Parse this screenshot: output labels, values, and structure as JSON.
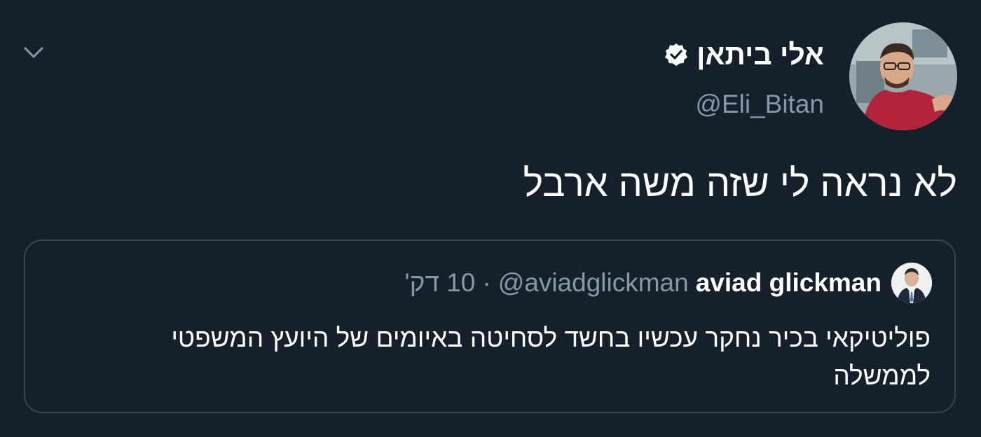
{
  "icons": {
    "chevron": "chevron-down-icon",
    "verified": "verified-badge-icon"
  },
  "colors": {
    "background": "#15202b",
    "text_primary": "#ffffff",
    "text_secondary": "#8899a6",
    "border": "#38444d"
  },
  "tweet": {
    "author": {
      "display_name": "אלי ביתאן",
      "handle": "@Eli_Bitan",
      "verified": true
    },
    "text": "לא נראה לי שזה משה ארבל"
  },
  "quoted_tweet": {
    "author": {
      "display_name": "aviad glickman",
      "handle": "@aviadglickman"
    },
    "separator": "·",
    "time": "10 דק'",
    "text": "פוליטיקאי בכיר נחקר עכשיו בחשד לסחיטה באיומים של היועץ המשפטי לממשלה"
  }
}
